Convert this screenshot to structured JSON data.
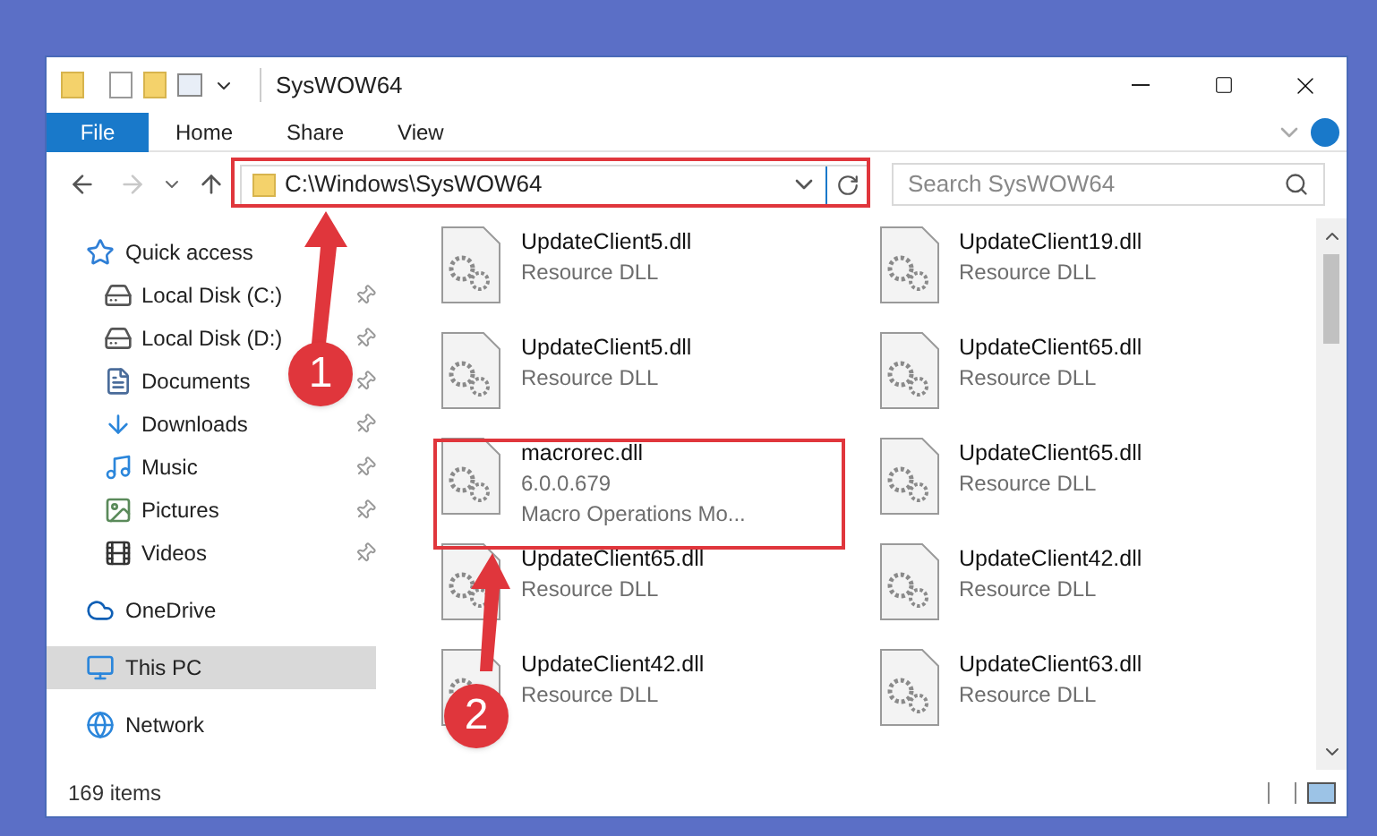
{
  "window": {
    "title": "SysWOW64"
  },
  "ribbon": {
    "tabs": [
      {
        "label": "File",
        "selected": true
      },
      {
        "label": "Home",
        "selected": false
      },
      {
        "label": "Share",
        "selected": false
      },
      {
        "label": "View",
        "selected": false
      }
    ]
  },
  "address": {
    "path": "C:\\Windows\\SysWOW64"
  },
  "search": {
    "placeholder": "Search SysWOW64"
  },
  "sidebar": {
    "items": [
      {
        "label": "Quick access",
        "selected": false,
        "children": [
          {
            "label": "Local Disk (C:)",
            "pinned": true,
            "selected": false
          },
          {
            "label": "Local Disk (D:)",
            "pinned": true,
            "selected": false
          },
          {
            "label": "Documents",
            "pinned": true,
            "selected": false
          },
          {
            "label": "Downloads",
            "pinned": true,
            "selected": false
          },
          {
            "label": "Music",
            "pinned": true,
            "selected": false
          },
          {
            "label": "Pictures",
            "pinned": true,
            "selected": false
          },
          {
            "label": "Videos",
            "pinned": true,
            "selected": false
          }
        ]
      },
      {
        "label": "OneDrive",
        "selected": false
      },
      {
        "label": "This PC",
        "selected": true
      },
      {
        "label": "Network",
        "selected": false
      }
    ]
  },
  "files": [
    {
      "name": "UpdateClient5.dll",
      "lines": [
        "Resource DLL"
      ]
    },
    {
      "name": "UpdateClient19.dll",
      "lines": [
        "Resource DLL"
      ]
    },
    {
      "name": "UpdateClient5.dll",
      "lines": [
        "Resource DLL"
      ]
    },
    {
      "name": "UpdateClient65.dll",
      "lines": [
        "Resource DLL"
      ]
    },
    {
      "name": "macrorec.dll",
      "lines": [
        "6.0.0.679",
        "Macro Operations Mo..."
      ]
    },
    {
      "name": "UpdateClient65.dll",
      "lines": [
        "Resource DLL"
      ]
    },
    {
      "name": "UpdateClient65.dll",
      "lines": [
        "Resource DLL"
      ]
    },
    {
      "name": "UpdateClient42.dll",
      "lines": [
        "Resource DLL"
      ]
    },
    {
      "name": "UpdateClient42.dll",
      "lines": [
        "Resource DLL"
      ]
    },
    {
      "name": "UpdateClient63.dll",
      "lines": [
        "Resource DLL"
      ]
    }
  ],
  "status_bar": {
    "count": "169 items"
  },
  "annotations": [
    {
      "label": "1"
    },
    {
      "label": "2"
    }
  ]
}
